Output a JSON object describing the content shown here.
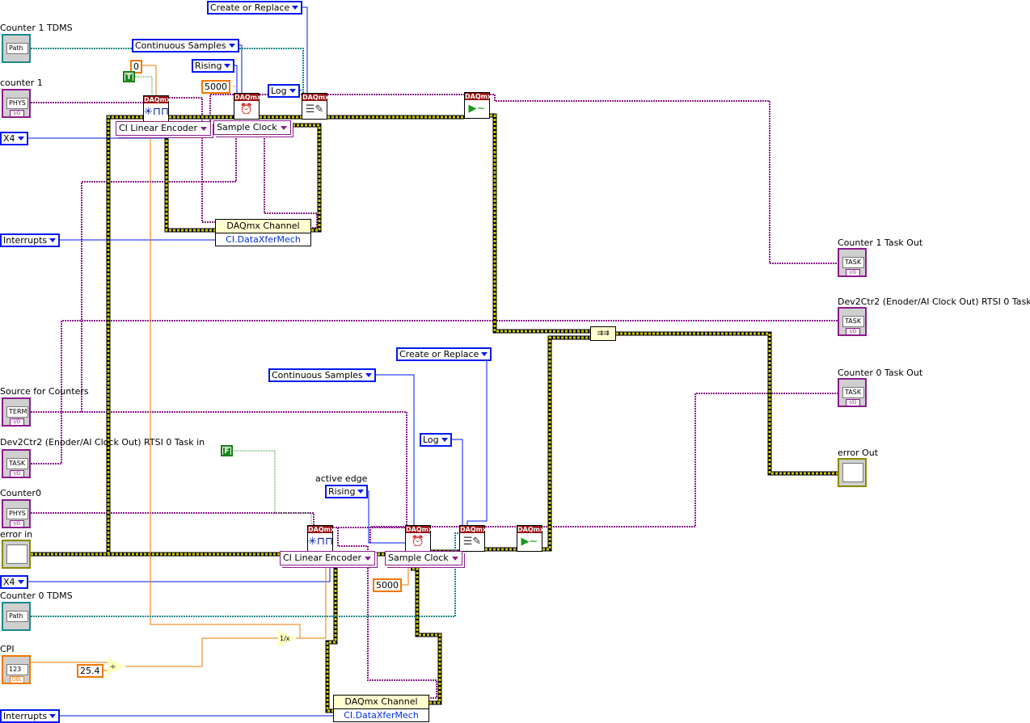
{
  "top": {
    "counter1_tdms": {
      "label": "Counter 1 TDMS",
      "terminal": "Path"
    },
    "counter1": {
      "label": "counter 1",
      "terminal": "PHYS",
      "sub": "I/O"
    },
    "x4": "X4",
    "interrupts": "Interrupts",
    "create_or_replace": "Create or Replace",
    "continuous_samples": "Continuous Samples",
    "initial_count": "0",
    "bool_true": "T",
    "rising": "Rising",
    "rate": "5000",
    "log": "Log",
    "ci_linear_encoder": "CI Linear Encoder",
    "sample_clock": "Sample Clock",
    "property_node": {
      "title": "DAQmx Channel",
      "property": "CI.DataXferMech"
    }
  },
  "bottom": {
    "source_for_counters": {
      "label": "Source for Counters",
      "terminal": "TERM",
      "sub": "I/O"
    },
    "task_in": {
      "label": "Dev2Ctr2 (Enoder/AI Clock Out) RTSI 0 Task in",
      "terminal": "TASK",
      "sub": "I/O"
    },
    "counter0": {
      "label": "Counter0",
      "terminal": "PHYS",
      "sub": "I/O"
    },
    "error_in": {
      "label": "error in"
    },
    "x4": "X4",
    "counter0_tdms": {
      "label": "Counter 0 TDMS",
      "terminal": "Path"
    },
    "cpi": {
      "label": "CPI",
      "terminal": "123",
      "sub": "DBL"
    },
    "interrupts": "Interrupts",
    "create_or_replace": "Create or Replace",
    "continuous_samples": "Continuous Samples",
    "log": "Log",
    "bool_false": "F",
    "active_edge_label": "active edge",
    "rising": "Rising",
    "ci_linear_encoder": "CI Linear Encoder",
    "sample_clock": "Sample Clock",
    "rate": "5000",
    "divisor": "25.4",
    "property_node": {
      "title": "DAQmx Channel",
      "property": "CI.DataXferMech"
    }
  },
  "outputs": {
    "counter1_task_out": {
      "label": "Counter 1 Task Out",
      "terminal": "TASK",
      "sub": "I/O"
    },
    "task_out": {
      "label": "Dev2Ctr2 (Enoder/AI Clock Out) RTSI 0 Task Out",
      "terminal": "TASK",
      "sub": "I/O"
    },
    "counter0_task_out": {
      "label": "Counter 0 Task Out",
      "terminal": "TASK",
      "sub": "I/O"
    },
    "error_out": {
      "label": "error Out"
    }
  },
  "daqmx_header": "DAQmx",
  "nodes": {
    "create_channel": "create-channel-icon",
    "timing": "sample-clock-icon",
    "logging": "configure-logging-icon",
    "start": "start-task-icon",
    "merge_errors": "merge-errors-icon",
    "reciprocal": "1/x",
    "divide": "divide-icon"
  },
  "colors": {
    "task_wire": "#8b1c8b",
    "error_wire": "#c8c800",
    "enum": "#0019f0",
    "numeric": "#f07800",
    "path": "#1a8a8a",
    "boolean": "#1a8a1a",
    "daqmx_header": "#9b1010"
  }
}
